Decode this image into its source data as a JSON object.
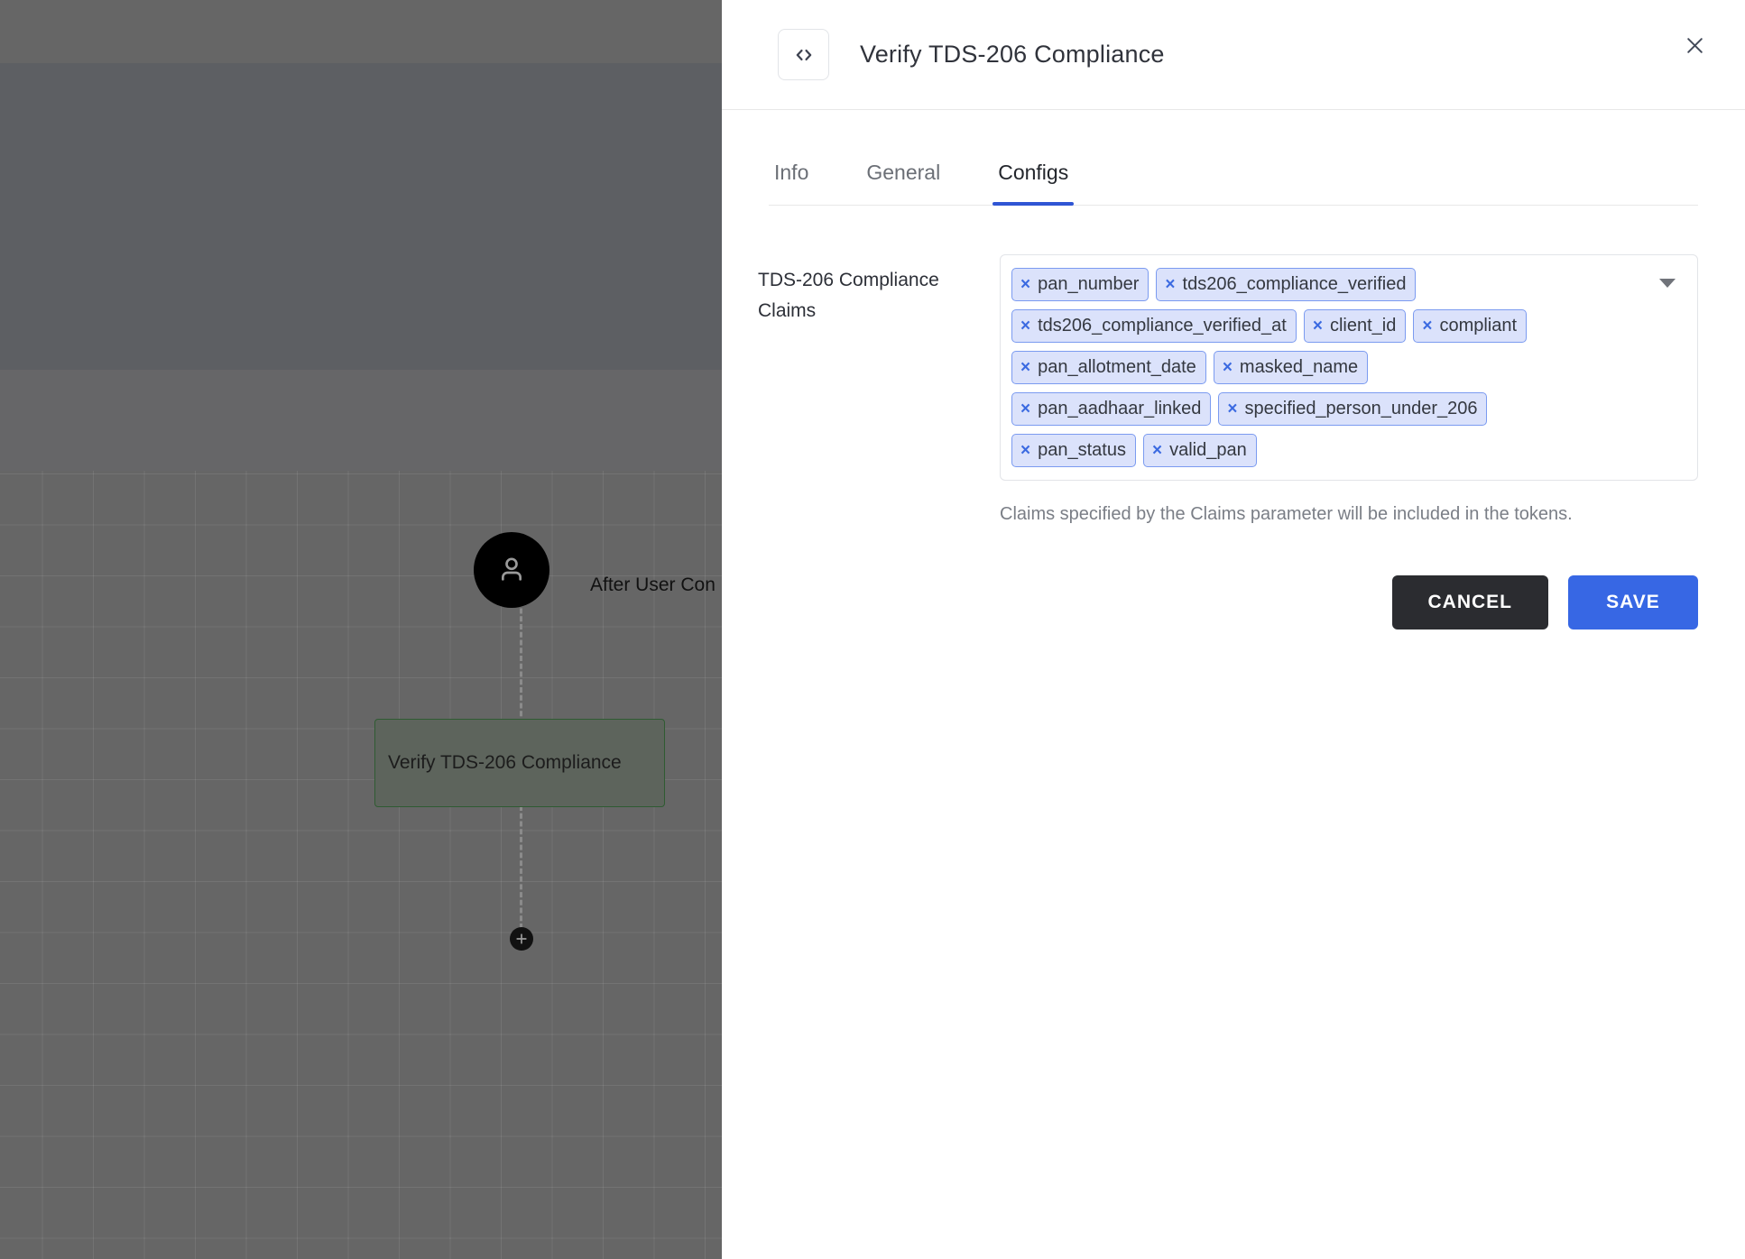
{
  "canvas": {
    "user_node": {
      "icon": "user-icon",
      "label": "After User Con"
    },
    "task_node": {
      "label": "Verify TDS-206 Compliance"
    },
    "add_button": {
      "icon": "plus-icon"
    }
  },
  "panel": {
    "header": {
      "icon": "code-icon",
      "title": "Verify TDS-206 Compliance",
      "close_icon": "close-icon"
    },
    "tabs": [
      {
        "label": "Info",
        "active": false
      },
      {
        "label": "General",
        "active": false
      },
      {
        "label": "Configs",
        "active": true
      }
    ],
    "field": {
      "label": "TDS-206 Compliance Claims",
      "chips": [
        "pan_number",
        "tds206_compliance_verified",
        "tds206_compliance_verified_at",
        "client_id",
        "compliant",
        "pan_allotment_date",
        "masked_name",
        "pan_aadhaar_linked",
        "specified_person_under_206",
        "pan_status",
        "valid_pan"
      ],
      "chip_remove_glyph": "×",
      "dropdown_icon": "chevron-down-icon",
      "helper_text": "Claims specified by the Claims parameter will be included in the tokens."
    },
    "actions": {
      "cancel_label": "CANCEL",
      "save_label": "SAVE"
    }
  },
  "colors": {
    "accent_blue": "#3767e4",
    "tab_underline": "#2f55d4",
    "chip_bg": "#dbe2fb",
    "chip_border": "#7b9bf0",
    "cancel_bg": "#2b2c30",
    "node_border_green": "#2f5b32"
  }
}
